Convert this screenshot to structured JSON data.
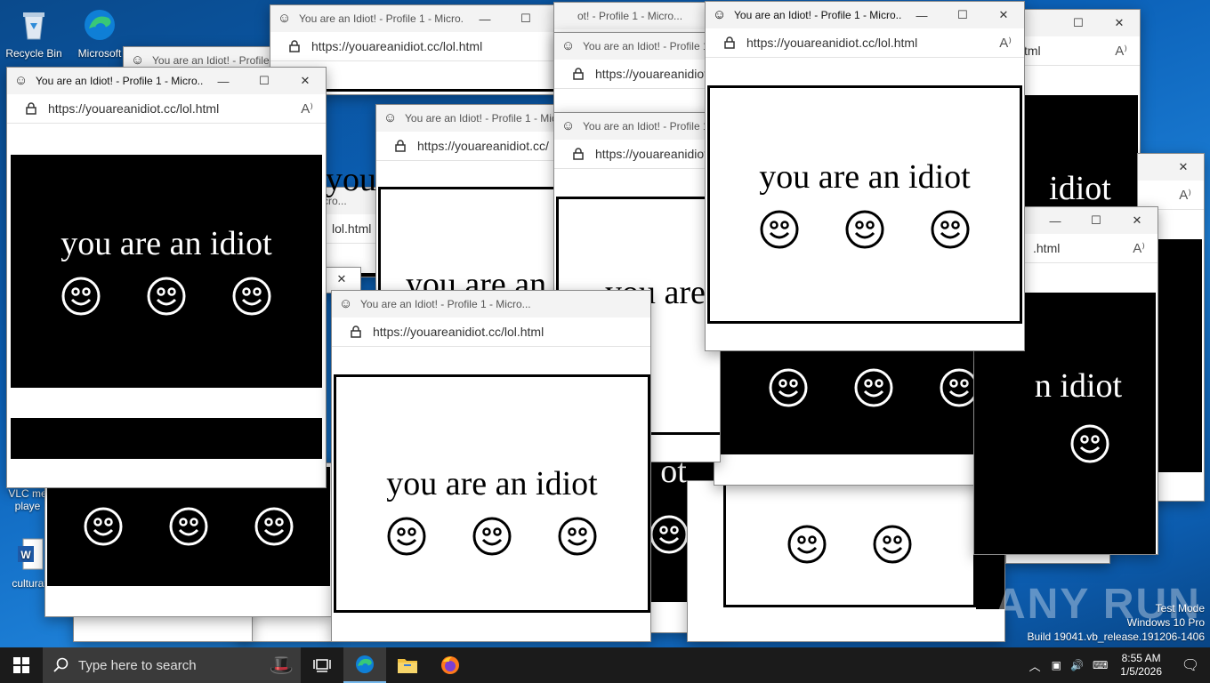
{
  "desktop": {
    "icons": [
      {
        "label": "Recycle Bin"
      },
      {
        "label": "Microsoft"
      },
      {
        "label": "VLC me playe"
      },
      {
        "label": "culturafr"
      }
    ]
  },
  "window": {
    "title_full": "You are an Idiot! - Profile 1 - Micro...",
    "title_short": "You are an Idiot! - Profile 1",
    "title_cut": "You are an Idiot! - Profile 1 - Mic",
    "title_prefix": "ot! - Profile 1 - Micro...",
    "url": "https://youareanidiot.cc/lol.html",
    "url_partial": "https://youareanidiot.cc/",
    "url_suffix": "lol.html",
    "url_tail": ".html",
    "url_frag": "tml",
    "message": "you are an idiot",
    "message_partial": "you are an",
    "message_short": "you are",
    "message_tail": "idiot",
    "message_tail2": "n idiot",
    "message_frag": "ot",
    "message_you": "you",
    "title_frag": "cro..."
  },
  "taskbar": {
    "search_placeholder": "Type here to search",
    "time": "8:55 AM",
    "date": "1/5/2026"
  },
  "watermark": {
    "line1": "Test Mode",
    "line2": "Windows 10 Pro",
    "line3": "Build 19041.vb_release.191206-1406",
    "brand": "ANY RUN"
  },
  "colors": {
    "edge_blue": "#0078d7",
    "taskbar": "#1b1b1b"
  }
}
